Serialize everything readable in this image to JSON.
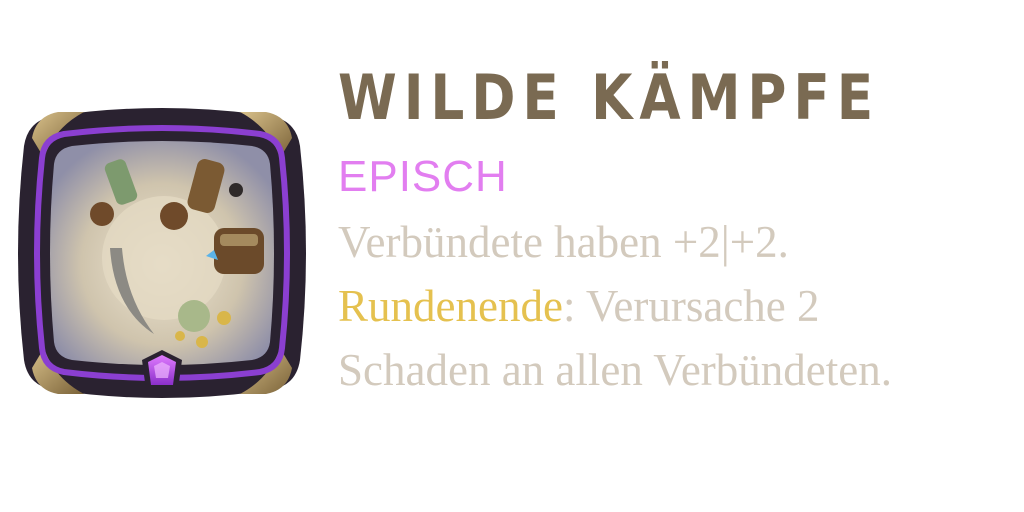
{
  "card": {
    "title": "WILDE KÄMPFE",
    "rarity": "EPISCH",
    "line1": "Verbündete haben +2|+2.",
    "keyword": "Rundenende",
    "line2_rest": ": Verursache 2",
    "line3": "Schaden an allen Verbündeten."
  },
  "colors": {
    "title": "#7a6a52",
    "rarity": "#e27ef0",
    "description": "#d3cabd",
    "keyword": "#e5c14f",
    "frame_purple": "#8b3fd1",
    "gem": "#b14be8"
  },
  "icons": {
    "artwork": "brawl-artwork-icon",
    "gem": "epic-gem-icon"
  }
}
